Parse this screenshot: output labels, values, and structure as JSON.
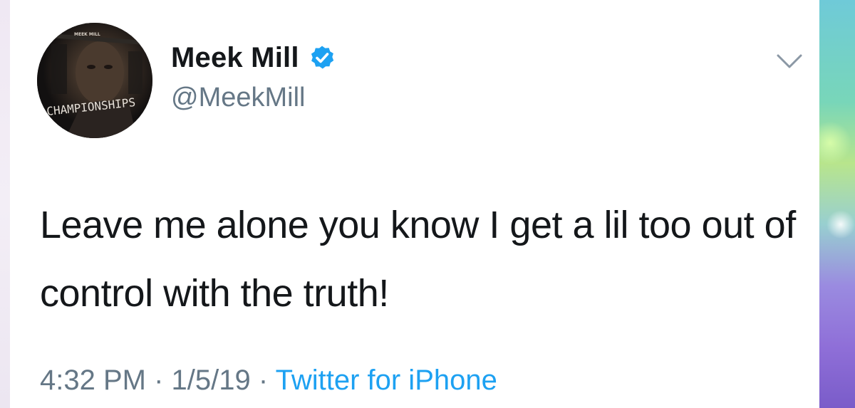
{
  "author": {
    "display_name": "Meek Mill",
    "handle": "@MeekMill",
    "verified": true,
    "avatar_caption": "CHAMPIONSHIPS",
    "avatar_top_text": "MEEK MILL"
  },
  "tweet": {
    "text": "Leave me alone you know I get a lil too out of control with the truth!",
    "time": "4:32 PM",
    "date": "1/5/19",
    "separator": "·",
    "source": "Twitter for iPhone"
  },
  "icons": {
    "verified_badge": "verified-badge-icon",
    "more_menu": "chevron-down-icon"
  },
  "colors": {
    "text_primary": "#14171a",
    "text_secondary": "#657786",
    "accent": "#1da1f2"
  }
}
